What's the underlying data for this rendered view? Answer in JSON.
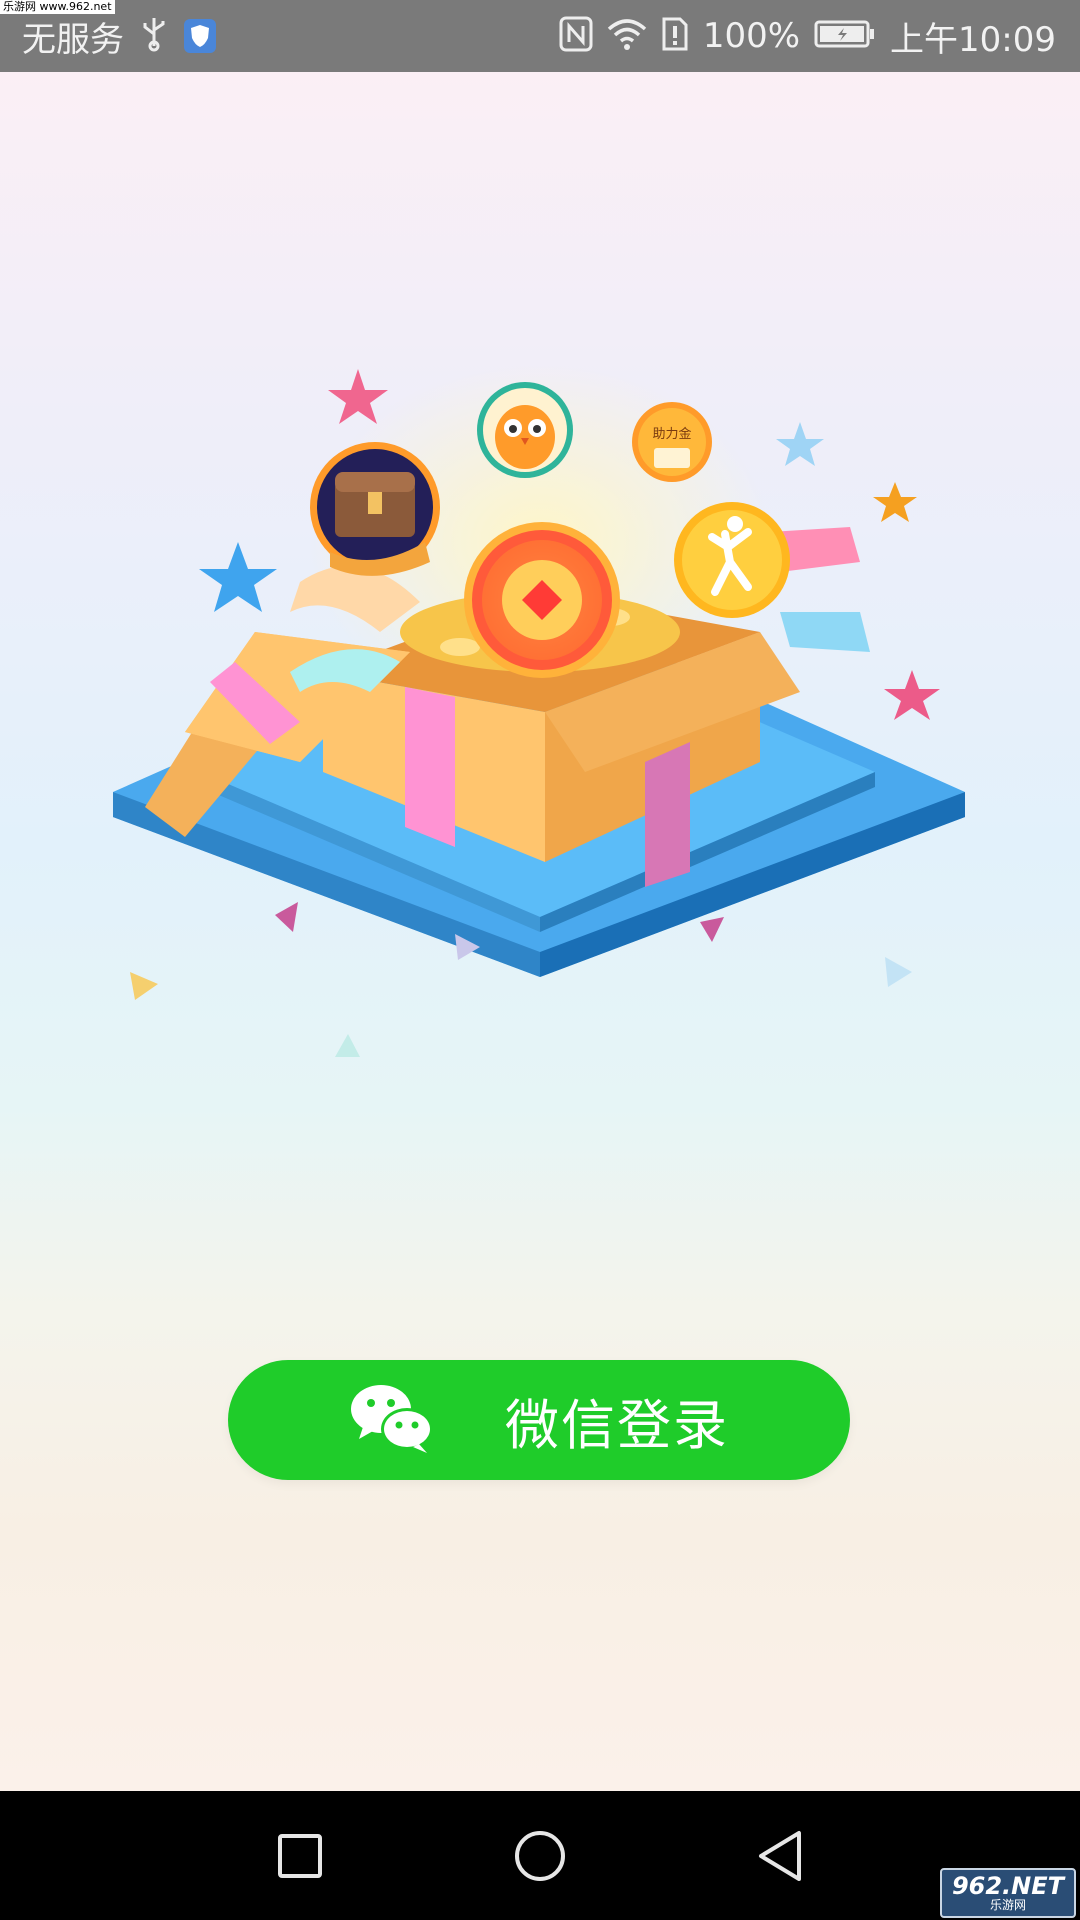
{
  "watermark": "乐游网 www.962.net",
  "status_bar": {
    "carrier": "无服务",
    "battery_percent": "100%",
    "time": "上午10:09",
    "icons": [
      "usb-icon",
      "shield-app-icon",
      "nfc-icon",
      "wifi-icon",
      "sim-alert-icon",
      "battery-charging-icon"
    ]
  },
  "illustration": {
    "coin_badge_text": "助力金"
  },
  "login_button": {
    "label": "微信登录",
    "icon": "wechat-icon",
    "color": "#1fcc2a"
  },
  "nav_bar": {
    "buttons": [
      "recents-button",
      "home-button",
      "back-button"
    ]
  },
  "corner_logo": {
    "main": "962.NET",
    "sub": "乐游网"
  }
}
